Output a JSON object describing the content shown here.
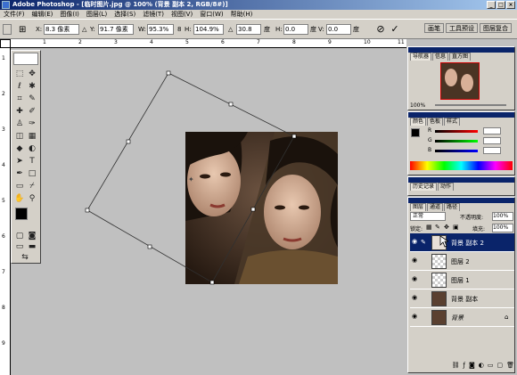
{
  "window": {
    "title": "Adobe Photoshop - [临时图片.jpg @ 100% (背景 副本 2, RGB/8#)]"
  },
  "menu": [
    "文件(F)",
    "编辑(E)",
    "图像(I)",
    "图层(L)",
    "选择(S)",
    "滤镜(T)",
    "视图(V)",
    "窗口(W)",
    "帮助(H)"
  ],
  "options": {
    "x_label": "X:",
    "x_value": "8.3 像素",
    "y_label": "Y:",
    "y_value": "91.7 像素",
    "w_label": "W:",
    "w_value": "95.3%",
    "h_label": "H:",
    "h_value": "104.9%",
    "angle_value": "30.8",
    "angle_unit": "度",
    "hskew_label": "H:",
    "hskew_value": "0.0",
    "hskew_unit": "度",
    "vskew_label": "V:",
    "vskew_value": "0.0",
    "vskew_unit": "度"
  },
  "palette_well": [
    "画笔",
    "工具预设",
    "图层复合"
  ],
  "rulers": {
    "h_ticks": [
      "1",
      "2",
      "3",
      "4",
      "5",
      "6",
      "7",
      "8",
      "9",
      "10",
      "11"
    ],
    "v_ticks": [
      "1",
      "2",
      "3",
      "4",
      "5",
      "6",
      "7",
      "8",
      "9"
    ]
  },
  "navigator": {
    "tabs": [
      "导航器",
      "信息",
      "直方图"
    ],
    "zoom": "100%"
  },
  "color_panel": {
    "tabs": [
      "颜色",
      "色板",
      "样式"
    ],
    "labels": [
      "R",
      "G",
      "B"
    ]
  },
  "history_panel": {
    "tabs": [
      "历史记录",
      "动作"
    ]
  },
  "layers_panel": {
    "tabs": [
      "图层",
      "通道",
      "路径"
    ],
    "blend_mode": "正常",
    "opacity_label": "不透明度:",
    "opacity_value": "100%",
    "lock_label": "锁定:",
    "fill_label": "填充:",
    "fill_value": "100%",
    "layers": [
      {
        "name": "背景 副本 2",
        "selected": true
      },
      {
        "name": "图层 2",
        "selected": false
      },
      {
        "name": "图层 1",
        "selected": false
      },
      {
        "name": "背景 副本",
        "selected": false
      },
      {
        "name": "背景",
        "selected": false
      }
    ]
  },
  "colors": {
    "accent": "#0a246a",
    "panel": "#d4d0c8",
    "workspace": "#c0c0c0"
  }
}
